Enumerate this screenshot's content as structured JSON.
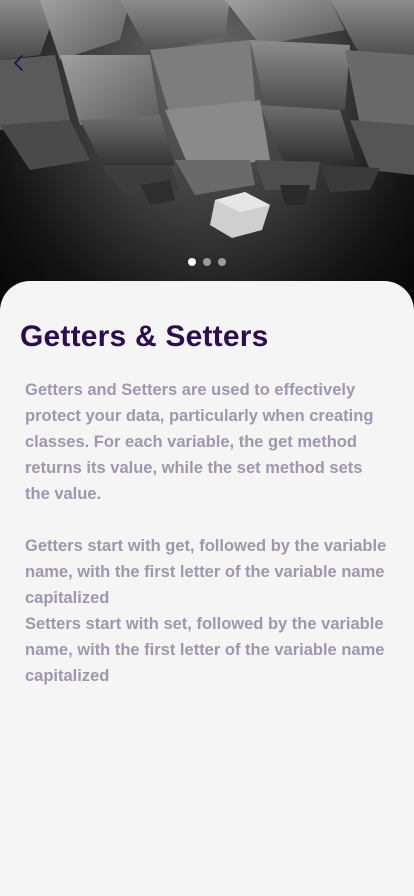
{
  "header": {
    "back_icon": "chevron-left-icon",
    "back_icon_color": "#2c0e4f"
  },
  "carousel": {
    "page_count": 3,
    "active_index": 0
  },
  "content": {
    "title": "Getters & Setters",
    "paragraphs": [
      "Getters and Setters are used to effectively protect your data, particularly when creating classes. For each variable, the get method returns its value, while the set method sets the value.",
      "Getters start with get, followed by the variable name, with the first letter of the variable name capitalized",
      "Setters start with set, followed by the variable name, with the first letter of the variable name capitalized"
    ]
  },
  "colors": {
    "title": "#2c0e4f",
    "body_text": "#a096ad",
    "card_background": "#f5f5f6",
    "dot_active": "#ffffff",
    "dot_inactive": "#9a9a9a"
  }
}
